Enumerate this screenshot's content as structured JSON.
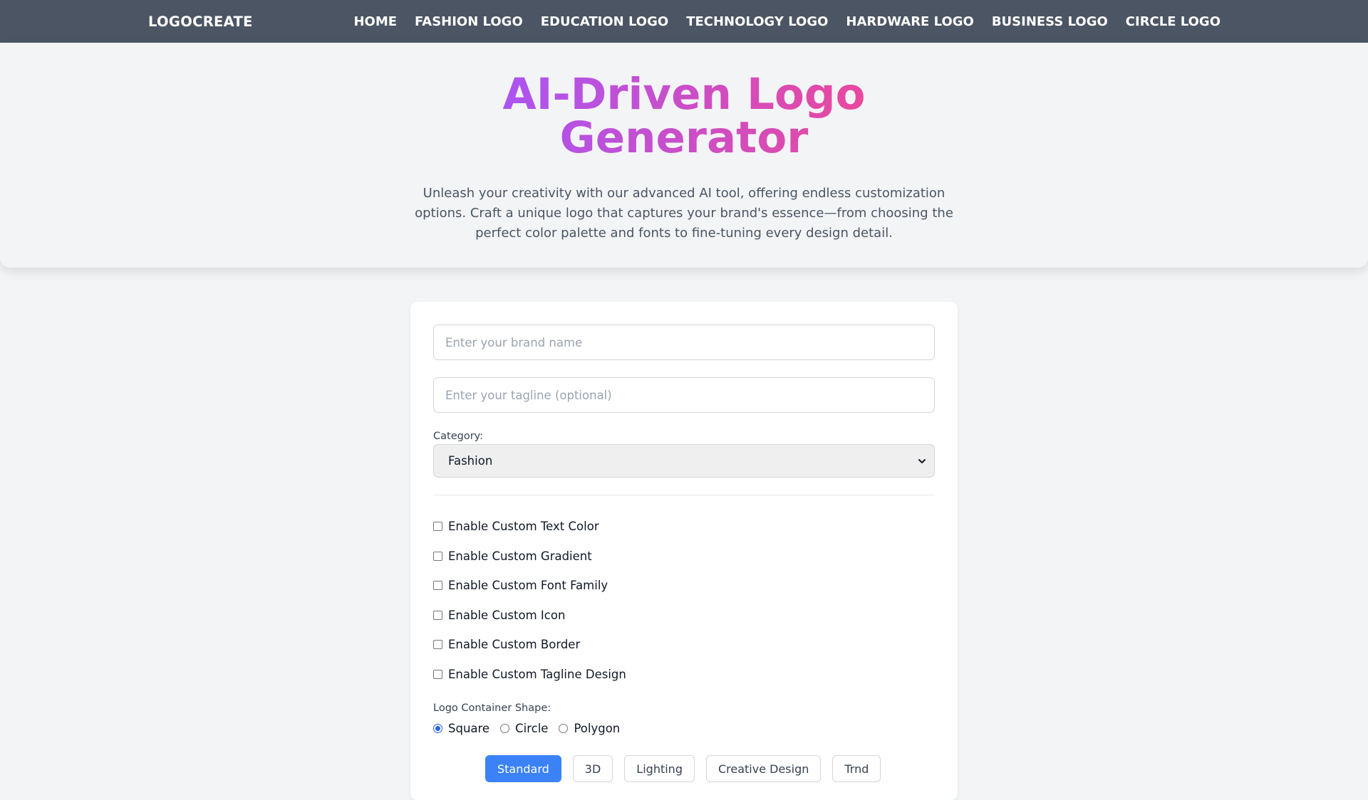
{
  "nav": {
    "brand": "LOGOCREATE",
    "links": [
      {
        "label": "HOME"
      },
      {
        "label": "FASHION LOGO"
      },
      {
        "label": "EDUCATION LOGO"
      },
      {
        "label": "TECHNOLOGY LOGO"
      },
      {
        "label": "HARDWARE LOGO"
      },
      {
        "label": "BUSINESS LOGO"
      },
      {
        "label": "CIRCLE LOGO"
      }
    ]
  },
  "hero": {
    "title": "AI-Driven Logo Generator",
    "subtitle": "Unleash your creativity with our advanced AI tool, offering endless customization options. Craft a unique logo that captures your brand's essence—from choosing the perfect color palette and fonts to fine-tuning every design detail.",
    "gradient_start": "#a855f7",
    "gradient_end": "#ec4899"
  },
  "form": {
    "brand_name": {
      "value": "",
      "placeholder": "Enter your brand name"
    },
    "tagline": {
      "value": "",
      "placeholder": "Enter your tagline (optional)"
    },
    "category": {
      "label": "Category:",
      "selected": "Fashion"
    },
    "options": [
      {
        "label": "Enable Custom Text Color",
        "checked": false
      },
      {
        "label": "Enable Custom Gradient",
        "checked": false
      },
      {
        "label": "Enable Custom Font Family",
        "checked": false
      },
      {
        "label": "Enable Custom Icon",
        "checked": false
      },
      {
        "label": "Enable Custom Border",
        "checked": false
      },
      {
        "label": "Enable Custom Tagline Design",
        "checked": false
      }
    ],
    "shape": {
      "label": "Logo Container Shape:",
      "choices": [
        {
          "label": "Square",
          "checked": true
        },
        {
          "label": "Circle",
          "checked": false
        },
        {
          "label": "Polygon",
          "checked": false
        }
      ]
    },
    "style_tabs": [
      {
        "label": "Standard",
        "active": true
      },
      {
        "label": "3D",
        "active": false
      },
      {
        "label": "Lighting",
        "active": false
      },
      {
        "label": "Creative Design",
        "active": false
      },
      {
        "label": "Trnd",
        "active": false
      }
    ]
  },
  "colors": {
    "nav_bg": "#4b5563",
    "page_bg": "#f3f4f6",
    "accent": "#3b82f6"
  }
}
